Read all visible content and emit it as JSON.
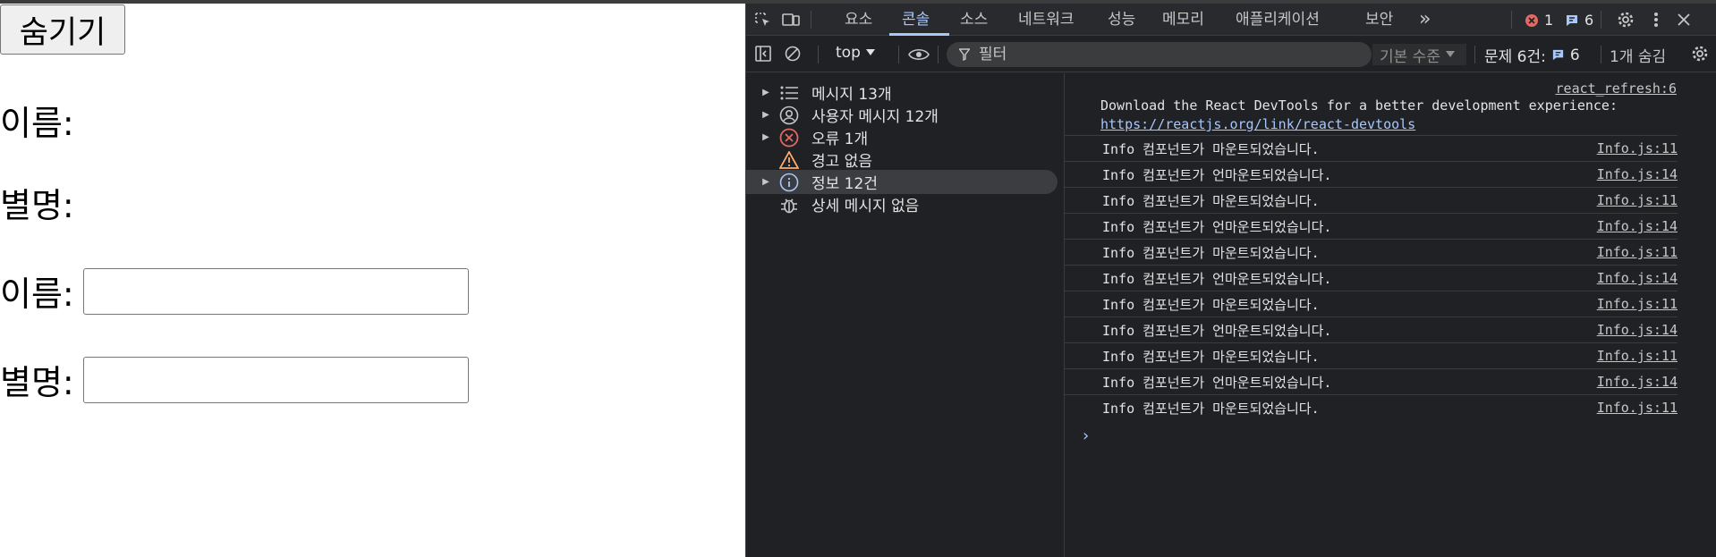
{
  "page": {
    "hide_button": "숨기기",
    "name_text_label": "이름:",
    "nickname_text_label": "별명:",
    "name_input_label": "이름:",
    "nickname_input_label": "별명:",
    "name_input_value": "",
    "nickname_input_value": ""
  },
  "devtools": {
    "tabs": [
      "요소",
      "콘솔",
      "소스",
      "네트워크",
      "성능",
      "메모리",
      "애플리케이션",
      "보안"
    ],
    "active_tab": "콘솔",
    "more_tabs": "»",
    "error_count": "1",
    "info_count": "6",
    "toolbar": {
      "context": "top",
      "filter_placeholder": "필터",
      "level": "기본 수준",
      "issues_label": "문제 6건:",
      "issues_count": "6",
      "hidden_label": "1개 숨김"
    },
    "sidebar": [
      {
        "label": "메시지 13개",
        "icon": "list-icon",
        "expandable": true
      },
      {
        "label": "사용자 메시지 12개",
        "icon": "user-icon",
        "expandable": true
      },
      {
        "label": "오류 1개",
        "icon": "error-icon",
        "expandable": true
      },
      {
        "label": "경고 없음",
        "icon": "warning-icon",
        "expandable": false
      },
      {
        "label": "정보 12건",
        "icon": "info-icon",
        "expandable": true
      },
      {
        "label": "상세 메시지 없음",
        "icon": "bug-icon",
        "expandable": false
      }
    ],
    "console": {
      "react_source": "react_refresh:6",
      "react_message": "Download the React DevTools for a better development experience:",
      "react_link": "https://reactjs.org/link/react-devtools",
      "logs": [
        {
          "msg": "Info 컴포넌트가 마운트되었습니다.",
          "src": "Info.js:11"
        },
        {
          "msg": "Info 컴포넌트가 언마운트되었습니다.",
          "src": "Info.js:14"
        },
        {
          "msg": "Info 컴포넌트가 마운트되었습니다.",
          "src": "Info.js:11"
        },
        {
          "msg": "Info 컴포넌트가 언마운트되었습니다.",
          "src": "Info.js:14"
        },
        {
          "msg": "Info 컴포넌트가 마운트되었습니다.",
          "src": "Info.js:11"
        },
        {
          "msg": "Info 컴포넌트가 언마운트되었습니다.",
          "src": "Info.js:14"
        },
        {
          "msg": "Info 컴포넌트가 마운트되었습니다.",
          "src": "Info.js:11"
        },
        {
          "msg": "Info 컴포넌트가 언마운트되었습니다.",
          "src": "Info.js:14"
        },
        {
          "msg": "Info 컴포넌트가 마운트되었습니다.",
          "src": "Info.js:11"
        },
        {
          "msg": "Info 컴포넌트가 언마운트되었습니다.",
          "src": "Info.js:14"
        },
        {
          "msg": "Info 컴포넌트가 마운트되었습니다.",
          "src": "Info.js:11"
        }
      ]
    }
  },
  "colors": {
    "accent": "#a8c7fa",
    "error": "#e46962",
    "warning": "#fcad70",
    "panel_bg": "#202124"
  }
}
